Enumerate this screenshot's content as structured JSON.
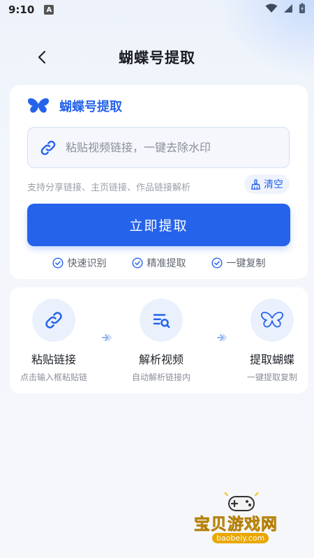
{
  "status_bar": {
    "time": "9:10",
    "badge": "A"
  },
  "header": {
    "title": "蝴蝶号提取"
  },
  "extract_card": {
    "brand_title": "蝴蝶号提取",
    "input_placeholder": "粘贴视频链接，一键去除水印",
    "support_text": "支持分享链接、主页链接、作品链接解析",
    "clear_label": "清空",
    "extract_button": "立即提取",
    "features": [
      "快速识别",
      "精准提取",
      "一键复制"
    ]
  },
  "steps": [
    {
      "icon": "link-icon",
      "title": "粘贴链接",
      "desc": "点击输入框粘贴链"
    },
    {
      "icon": "video-search-icon",
      "title": "解析视频",
      "desc": "自动解析链接内"
    },
    {
      "icon": "butterfly-icon",
      "title": "提取蝴蝶",
      "desc": "一键提取复制"
    }
  ],
  "watermark": {
    "title": "宝贝游戏网",
    "url": "baobeiy.com"
  },
  "colors": {
    "accent": "#2563eb",
    "accent_light": "#eaf1fd",
    "text_primary": "#1f2329",
    "text_secondary": "#8a8f99"
  }
}
